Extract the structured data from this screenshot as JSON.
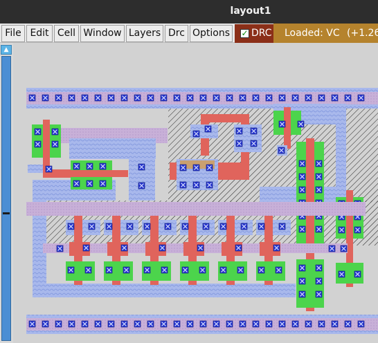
{
  "window": {
    "title": "layout1"
  },
  "menu": [
    {
      "label": "File"
    },
    {
      "label": "Edit"
    },
    {
      "label": "Cell"
    },
    {
      "label": "Window"
    },
    {
      "label": "Layers"
    },
    {
      "label": "Drc"
    },
    {
      "label": "Options"
    }
  ],
  "drc_toggle": {
    "label": "DRC",
    "checked": true
  },
  "status": {
    "loaded": "Loaded: VC",
    "coord": "(+1.26"
  },
  "scrollbar": {
    "up_arrow": "▲"
  },
  "colors": {
    "metal1": "#a8b8ec",
    "metal2": "#c8b0d8",
    "poly": "#e0645c",
    "diffusion": "#4cd44c",
    "contact": "#2636d0",
    "well_hatch": "#1e1e1e",
    "canvas_bg": "#d2d2d2"
  }
}
